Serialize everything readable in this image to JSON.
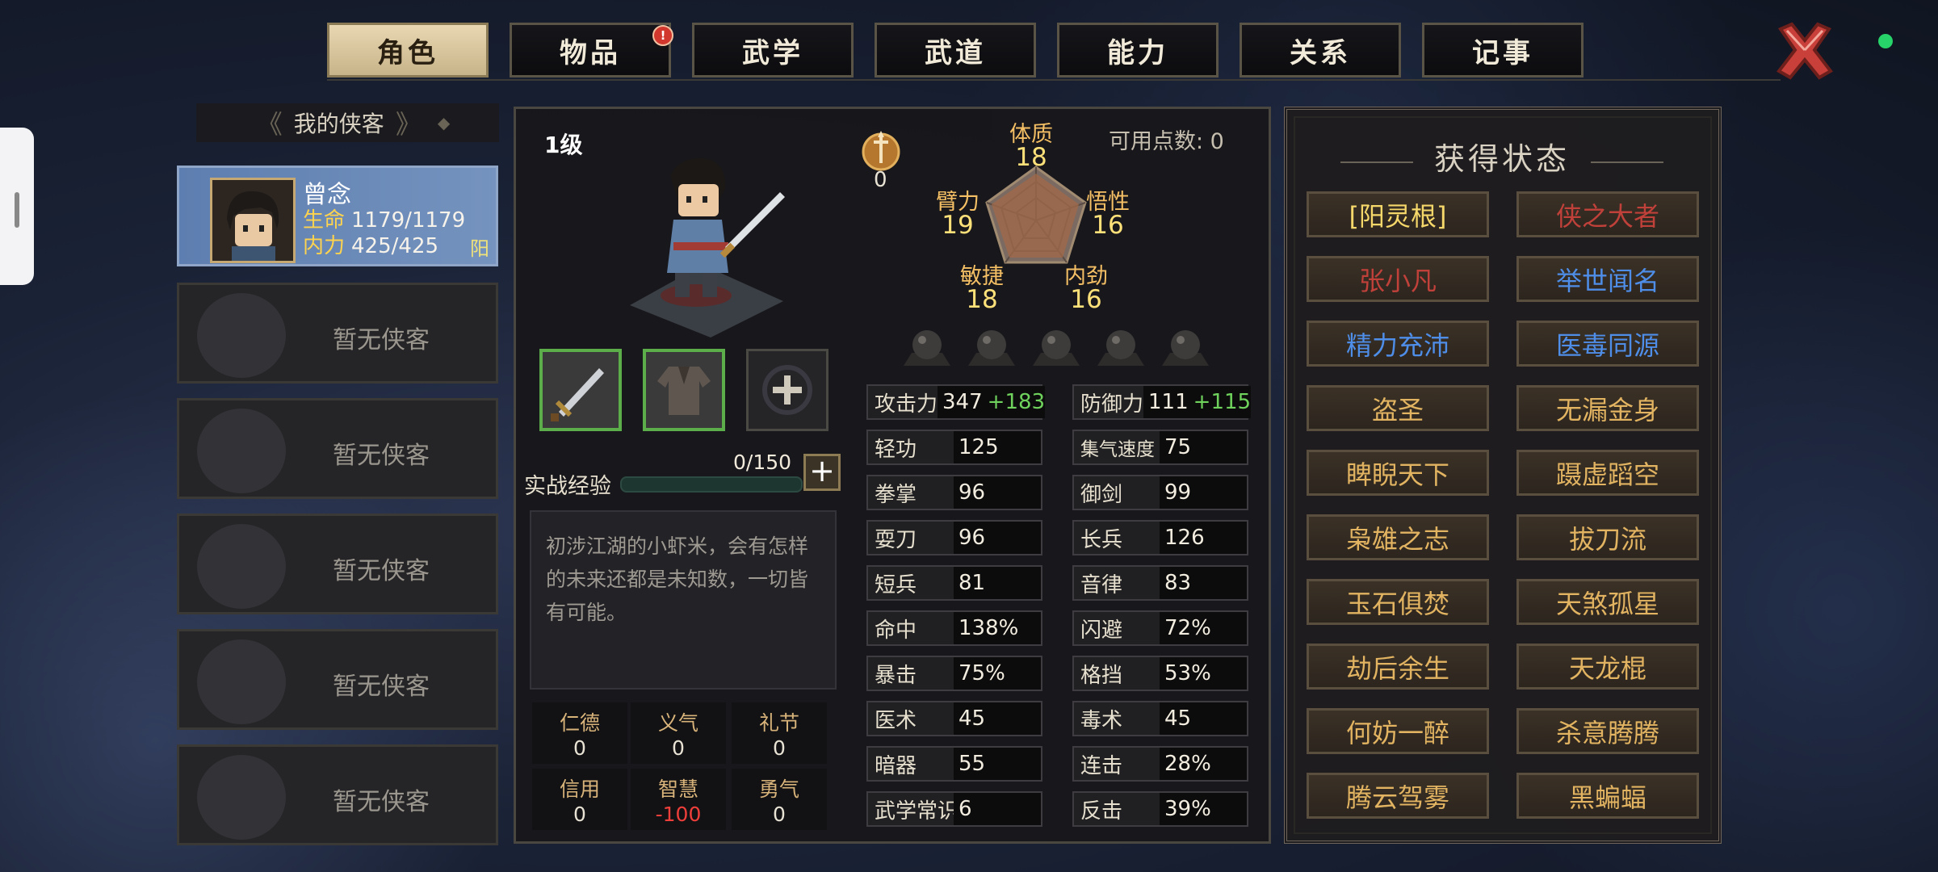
{
  "tabs": [
    {
      "label": "角色",
      "active": true
    },
    {
      "label": "物品",
      "badge": "!"
    },
    {
      "label": "武学"
    },
    {
      "label": "武道"
    },
    {
      "label": "能力"
    },
    {
      "label": "关系"
    },
    {
      "label": "记事"
    }
  ],
  "heroes_heading": "我的侠客",
  "selected_hero": {
    "name": "曾念",
    "hp_label": "生命",
    "hp": "1179/1179",
    "mp_label": "内力",
    "mp": "425/425",
    "tag": "阳"
  },
  "empty_slot_text": "暂无侠客",
  "empty_slots": [
    "暂无侠客",
    "暂无侠客",
    "暂无侠客",
    "暂无侠客",
    "暂无侠客"
  ],
  "level": "1级",
  "badge_value": "0",
  "available_points": "可用点数: 0",
  "attributes": {
    "tizhi": {
      "label": "体质",
      "value": "18"
    },
    "bili": {
      "label": "臂力",
      "value": "19"
    },
    "wuxing": {
      "label": "悟性",
      "value": "16"
    },
    "minjie": {
      "label": "敏捷",
      "value": "18"
    },
    "neijin": {
      "label": "内劲",
      "value": "16"
    }
  },
  "exp": {
    "label": "实战经验",
    "value": "0/150",
    "fraction": 0
  },
  "description": "初涉江湖的小虾米，会有怎样的未来还都是未知数，一切皆有可能。",
  "virtues": [
    {
      "name": "仁德",
      "value": "0"
    },
    {
      "name": "义气",
      "value": "0"
    },
    {
      "name": "礼节",
      "value": "0"
    },
    {
      "name": "信用",
      "value": "0"
    },
    {
      "name": "智慧",
      "value": "-100"
    },
    {
      "name": "勇气",
      "value": "0"
    }
  ],
  "stats_left": [
    {
      "k": "攻击力",
      "v": "347",
      "bonus": "+183"
    },
    {
      "k": "轻功",
      "v": "125"
    },
    {
      "k": "拳掌",
      "v": "96"
    },
    {
      "k": "耍刀",
      "v": "96"
    },
    {
      "k": "短兵",
      "v": "81"
    },
    {
      "k": "命中",
      "v": "138%"
    },
    {
      "k": "暴击",
      "v": "75%"
    },
    {
      "k": "医术",
      "v": "45"
    },
    {
      "k": "暗器",
      "v": "55"
    },
    {
      "k": "武学常识",
      "v": "6"
    }
  ],
  "stats_right": [
    {
      "k": "防御力",
      "v": "111",
      "bonus": "+115"
    },
    {
      "k": "集气速度",
      "v": "75"
    },
    {
      "k": "御剑",
      "v": "99"
    },
    {
      "k": "长兵",
      "v": "126"
    },
    {
      "k": "音律",
      "v": "83"
    },
    {
      "k": "闪避",
      "v": "72%"
    },
    {
      "k": "格挡",
      "v": "53%"
    },
    {
      "k": "毒术",
      "v": "45"
    },
    {
      "k": "连击",
      "v": "28%"
    },
    {
      "k": "反击",
      "v": "39%"
    }
  ],
  "status_title": "获得状态",
  "statuses": [
    {
      "label": "[阳灵根]",
      "color": "#f5d76a"
    },
    {
      "label": "侠之大者",
      "color": "#c0403a"
    },
    {
      "label": "张小凡",
      "color": "#c0403a"
    },
    {
      "label": "举世闻名",
      "color": "#4f8ee8"
    },
    {
      "label": "精力充沛",
      "color": "#4f8ee8"
    },
    {
      "label": "医毒同源",
      "color": "#4f8ee8"
    },
    {
      "label": "盗圣",
      "color": "#e2b462"
    },
    {
      "label": "无漏金身",
      "color": "#e2b462"
    },
    {
      "label": "睥睨天下",
      "color": "#e2b462"
    },
    {
      "label": "蹑虚蹈空",
      "color": "#e2b462"
    },
    {
      "label": "枭雄之志",
      "color": "#e2b462"
    },
    {
      "label": "拔刀流",
      "color": "#e2b462"
    },
    {
      "label": "玉石俱焚",
      "color": "#e2b462"
    },
    {
      "label": "天煞孤星",
      "color": "#e2b462"
    },
    {
      "label": "劫后余生",
      "color": "#e2b462"
    },
    {
      "label": "天龙棍",
      "color": "#e2b462"
    },
    {
      "label": "何妨一醉",
      "color": "#e2b462"
    },
    {
      "label": "杀意腾腾",
      "color": "#e2b462"
    },
    {
      "label": "腾云驾雾",
      "color": "#e2b462"
    },
    {
      "label": "黑蝙蝠",
      "color": "#e2b462"
    }
  ]
}
